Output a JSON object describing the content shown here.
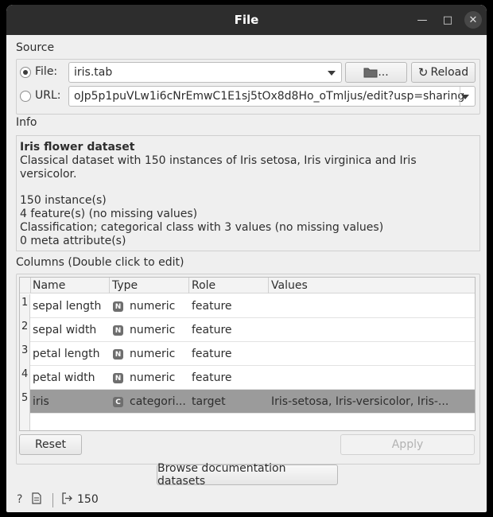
{
  "window": {
    "title": "File"
  },
  "source": {
    "label": "Source",
    "file_label": "File:",
    "file_value": "iris.tab",
    "browse_label": "...",
    "reload_label": "Reload",
    "url_label": "URL:",
    "url_value": "oJp5p1puVLw1i6cNrEmwC1E1sj5tOx8d8Ho_oTmljus/edit?usp=sharing"
  },
  "info": {
    "label": "Info",
    "title": "Iris flower dataset",
    "description": "Classical dataset with 150 instances of Iris setosa, Iris virginica and Iris versicolor.",
    "instances": "150 instance(s)",
    "features": "4 feature(s) (no missing values)",
    "classification": "Classification; categorical class with 3 values (no missing values)",
    "meta": "0 meta attribute(s)"
  },
  "columns": {
    "label": "Columns (Double click to edit)",
    "headers": [
      "Name",
      "Type",
      "Role",
      "Values"
    ],
    "rows": [
      {
        "num": "1",
        "name": "sepal length",
        "badge": "N",
        "type": "numeric",
        "role": "feature",
        "values": ""
      },
      {
        "num": "2",
        "name": "sepal width",
        "badge": "N",
        "type": "numeric",
        "role": "feature",
        "values": ""
      },
      {
        "num": "3",
        "name": "petal length",
        "badge": "N",
        "type": "numeric",
        "role": "feature",
        "values": ""
      },
      {
        "num": "4",
        "name": "petal width",
        "badge": "N",
        "type": "numeric",
        "role": "feature",
        "values": ""
      },
      {
        "num": "5",
        "name": "iris",
        "badge": "C",
        "type": "categori...",
        "role": "target",
        "values": "Iris-setosa, Iris-versicolor, Iris-..."
      }
    ]
  },
  "buttons": {
    "reset": "Reset",
    "apply": "Apply",
    "browse_docs": "Browse documentation datasets"
  },
  "status": {
    "output_count": "150"
  },
  "colors": {
    "titlebar": "#2d2d2d",
    "window_bg": "#efefef",
    "selected_row": "#9b9b9b"
  }
}
